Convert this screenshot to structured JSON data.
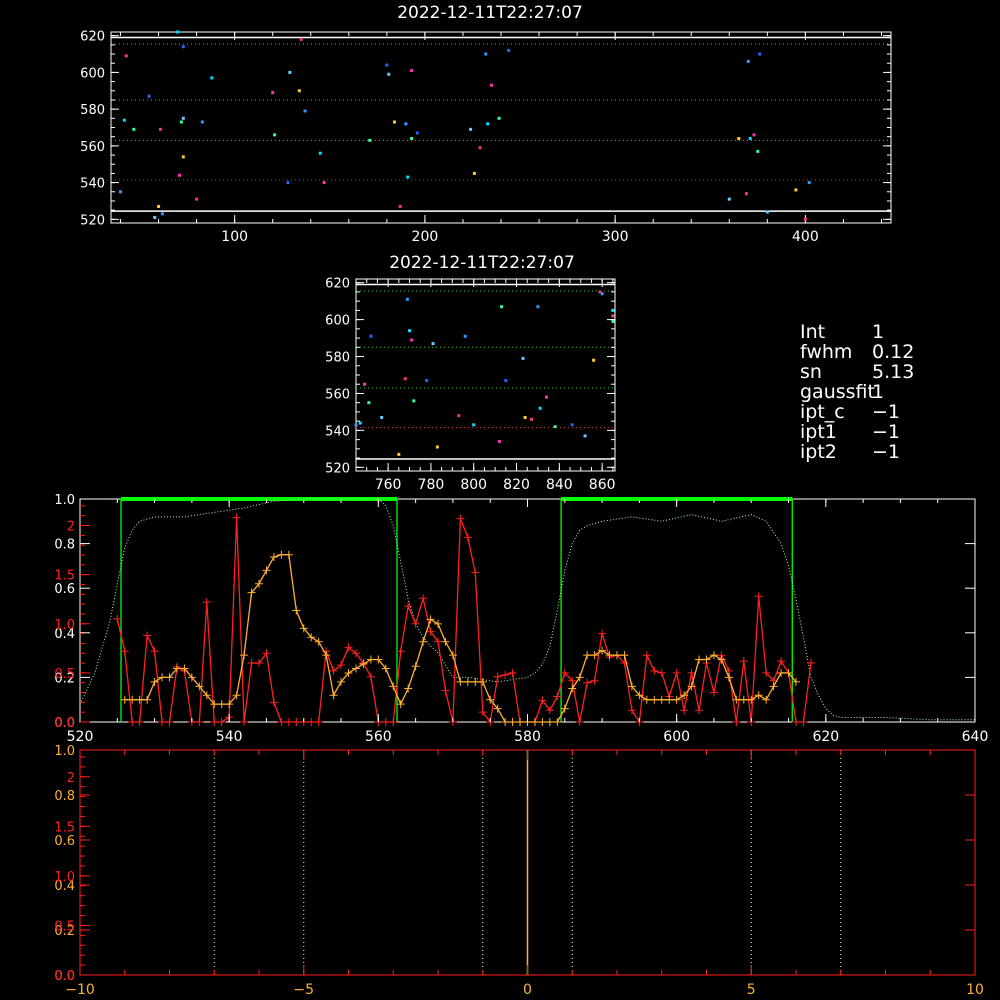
{
  "colors": {
    "bg": "#000000",
    "axis": "#ffffff",
    "red": "#ff2020",
    "orange": "#ffb030",
    "green": "#00ff00",
    "gdot": "#33cc33",
    "lgreen": "#b0ffb0"
  },
  "chart_data": [
    {
      "type": "scatter",
      "title": "2022-12-11T22:27:07",
      "xlim": [
        35,
        445
      ],
      "ylim": [
        518,
        622
      ],
      "xticks": [
        100,
        200,
        300,
        400
      ],
      "yticks": [
        520,
        540,
        560,
        580,
        600,
        620
      ],
      "white_lines_y": [
        524.5,
        619
      ],
      "dotted_lines_y": [
        541.5,
        563,
        585,
        615.5
      ],
      "points": [
        [
          40,
          535
        ],
        [
          42,
          574
        ],
        [
          43,
          609
        ],
        [
          47,
          569
        ],
        [
          55,
          587
        ],
        [
          58,
          521
        ],
        [
          60,
          527
        ],
        [
          61,
          569
        ],
        [
          62,
          523
        ],
        [
          70,
          622
        ],
        [
          71,
          544
        ],
        [
          72,
          573
        ],
        [
          73,
          614
        ],
        [
          73,
          575
        ],
        [
          73,
          554
        ],
        [
          80,
          531
        ],
        [
          83,
          573
        ],
        [
          88,
          597
        ],
        [
          120,
          589
        ],
        [
          121,
          566
        ],
        [
          128,
          540
        ],
        [
          129,
          600
        ],
        [
          134,
          590
        ],
        [
          135,
          618
        ],
        [
          137,
          579
        ],
        [
          145,
          556
        ],
        [
          147,
          540
        ],
        [
          171,
          563
        ],
        [
          180,
          604
        ],
        [
          181,
          599
        ],
        [
          184,
          573
        ],
        [
          187,
          527
        ],
        [
          190,
          572
        ],
        [
          191,
          543
        ],
        [
          193,
          601
        ],
        [
          193,
          564
        ],
        [
          196,
          567
        ],
        [
          224,
          569
        ],
        [
          226,
          545
        ],
        [
          229,
          559
        ],
        [
          232,
          610
        ],
        [
          233,
          572
        ],
        [
          235,
          593
        ],
        [
          239,
          575
        ],
        [
          244,
          612
        ],
        [
          360,
          531
        ],
        [
          365,
          564
        ],
        [
          369,
          534
        ],
        [
          370,
          606
        ],
        [
          371,
          564
        ],
        [
          373,
          566
        ],
        [
          375,
          557
        ],
        [
          376,
          610
        ],
        [
          380,
          524
        ],
        [
          395,
          536
        ],
        [
          400,
          520
        ],
        [
          402,
          540
        ]
      ]
    },
    {
      "type": "scatter",
      "title": "2022-12-11T22:27:07",
      "xlim": [
        745,
        866
      ],
      "ylim": [
        518,
        622
      ],
      "xticks": [
        760,
        780,
        800,
        820,
        840,
        860
      ],
      "yticks": [
        520,
        540,
        560,
        580,
        600,
        620
      ],
      "white_lines_y": [
        524.5,
        619
      ],
      "dotted_lines_y": [
        541.5,
        563,
        585,
        615.5
      ],
      "points": [
        [
          745,
          543
        ],
        [
          747,
          544
        ],
        [
          749,
          565
        ],
        [
          751,
          555
        ],
        [
          752,
          591
        ],
        [
          757,
          547
        ],
        [
          765,
          527
        ],
        [
          768,
          568
        ],
        [
          769,
          611
        ],
        [
          770,
          594
        ],
        [
          771,
          589
        ],
        [
          772,
          556
        ],
        [
          778,
          567
        ],
        [
          781,
          587
        ],
        [
          783,
          531
        ],
        [
          793,
          548
        ],
        [
          796,
          591
        ],
        [
          800,
          543
        ],
        [
          812,
          534
        ],
        [
          813,
          607
        ],
        [
          815,
          567
        ],
        [
          823,
          579
        ],
        [
          824,
          547
        ],
        [
          827,
          546
        ],
        [
          830,
          607
        ],
        [
          831,
          552
        ],
        [
          834,
          558
        ],
        [
          838,
          542
        ],
        [
          846,
          543
        ],
        [
          852,
          537
        ],
        [
          856,
          578
        ],
        [
          859,
          615
        ],
        [
          860,
          614
        ],
        [
          865,
          605
        ],
        [
          865,
          602
        ],
        [
          865,
          599
        ]
      ]
    },
    {
      "type": "line",
      "xlim": [
        520,
        640
      ],
      "xticks": [
        520,
        540,
        560,
        580,
        600,
        620,
        640
      ],
      "ylim_left": [
        0,
        1.0
      ],
      "yticks_left": [
        0.0,
        0.2,
        0.4,
        0.6,
        0.8,
        1.0
      ],
      "ylim_red": [
        0,
        2.27
      ],
      "yticks_red": [
        0.0,
        0.5,
        1.0,
        1.5,
        2.0
      ],
      "filter_x": [
        520,
        522,
        524,
        525,
        526,
        527,
        528,
        530,
        534,
        538,
        542,
        546,
        550,
        556,
        560,
        561,
        562,
        563,
        564,
        565,
        566,
        567,
        568,
        570,
        572,
        574,
        576,
        578,
        580,
        581,
        582,
        583,
        584,
        585,
        586,
        587,
        588,
        590,
        594,
        598,
        602,
        606,
        610,
        612,
        614,
        615,
        616,
        617,
        618,
        619,
        620,
        621,
        622,
        624,
        628,
        634,
        640
      ],
      "filter_y": [
        0.08,
        0.22,
        0.45,
        0.62,
        0.78,
        0.86,
        0.9,
        0.92,
        0.92,
        0.94,
        0.96,
        0.99,
        1.0,
        1.0,
        1.0,
        0.97,
        0.88,
        0.72,
        0.55,
        0.44,
        0.38,
        0.34,
        0.31,
        0.2,
        0.2,
        0.19,
        0.18,
        0.19,
        0.2,
        0.22,
        0.26,
        0.34,
        0.5,
        0.68,
        0.8,
        0.86,
        0.88,
        0.9,
        0.92,
        0.9,
        0.93,
        0.9,
        0.93,
        0.9,
        0.8,
        0.7,
        0.55,
        0.38,
        0.2,
        0.12,
        0.06,
        0.03,
        0.02,
        0.02,
        0.02,
        0.01,
        0.01
      ],
      "passbands": [
        [
          525.5,
          562.5
        ],
        [
          584.5,
          615.5
        ]
      ],
      "red": {
        "x": [
          525,
          526,
          527,
          528,
          529,
          530,
          531,
          532,
          533,
          534,
          535,
          536,
          537,
          538,
          539,
          540,
          541,
          542,
          543,
          544,
          545,
          546,
          547,
          548,
          549,
          550,
          551,
          552,
          553,
          554,
          555,
          556,
          557,
          558,
          559,
          560,
          561,
          562,
          563,
          564,
          565,
          566,
          567,
          568,
          569,
          570,
          571,
          572,
          573,
          574,
          575,
          576,
          577,
          578,
          579,
          580,
          581,
          582,
          583,
          584,
          585,
          586,
          587,
          588,
          589,
          590,
          591,
          592,
          593,
          594,
          595,
          596,
          597,
          598,
          599,
          600,
          601,
          602,
          603,
          604,
          605,
          606,
          607,
          608,
          609,
          610,
          611,
          612,
          613,
          614,
          615,
          616,
          617,
          618
        ],
        "y": [
          1.05,
          0.72,
          0.0,
          0.0,
          0.88,
          0.72,
          0.0,
          0.0,
          0.56,
          0.52,
          0.0,
          0.0,
          1.22,
          0.0,
          0.0,
          0.05,
          2.08,
          0.0,
          0.6,
          0.6,
          0.7,
          0.2,
          0.0,
          0.0,
          0.0,
          0.0,
          0.0,
          0.0,
          0.72,
          0.52,
          0.58,
          0.76,
          0.7,
          0.6,
          0.46,
          0.0,
          0.0,
          0.0,
          0.72,
          1.18,
          1.0,
          1.26,
          0.92,
          0.82,
          0.32,
          0.0,
          2.07,
          1.88,
          1.52,
          0.1,
          0.0,
          0.46,
          0.48,
          0.5,
          0.0,
          0.0,
          0.0,
          0.22,
          0.12,
          0.26,
          0.5,
          0.42,
          0.0,
          0.4,
          0.42,
          0.9,
          0.66,
          0.68,
          0.6,
          0.12,
          0.0,
          0.68,
          0.52,
          0.5,
          0.26,
          0.5,
          0.12,
          0.5,
          0.12,
          0.6,
          0.3,
          0.68,
          0.52,
          0.0,
          0.62,
          0.0,
          1.28,
          0.5,
          0.42,
          0.62,
          0.5,
          0.0,
          0.0,
          0.6
        ]
      },
      "orange": {
        "x": [
          526,
          527,
          528,
          529,
          530,
          531,
          532,
          533,
          534,
          535,
          536,
          537,
          538,
          539,
          540,
          541,
          542,
          543,
          544,
          545,
          546,
          547,
          548,
          549,
          550,
          551,
          552,
          553,
          554,
          555,
          556,
          557,
          558,
          559,
          560,
          561,
          562,
          563,
          564,
          565,
          566,
          567,
          568,
          569,
          570,
          571,
          572,
          573,
          574,
          575,
          576,
          577,
          578,
          579,
          580,
          581,
          582,
          583,
          584,
          585,
          586,
          587,
          588,
          589,
          590,
          591,
          592,
          593,
          594,
          595,
          596,
          597,
          598,
          599,
          600,
          601,
          602,
          603,
          604,
          605,
          606,
          607,
          608,
          609,
          610,
          611,
          612,
          613,
          614,
          615,
          616
        ],
        "y": [
          0.1,
          0.1,
          0.1,
          0.1,
          0.18,
          0.2,
          0.2,
          0.24,
          0.24,
          0.2,
          0.16,
          0.12,
          0.08,
          0.08,
          0.08,
          0.12,
          0.3,
          0.58,
          0.62,
          0.68,
          0.74,
          0.75,
          0.75,
          0.5,
          0.42,
          0.38,
          0.36,
          0.3,
          0.12,
          0.18,
          0.22,
          0.24,
          0.26,
          0.28,
          0.28,
          0.24,
          0.16,
          0.08,
          0.15,
          0.25,
          0.36,
          0.46,
          0.44,
          0.36,
          0.3,
          0.18,
          0.18,
          0.18,
          0.18,
          0.1,
          0.06,
          0.0,
          0.0,
          0.0,
          0.0,
          0.0,
          0.0,
          0.0,
          0.0,
          0.06,
          0.15,
          0.2,
          0.3,
          0.3,
          0.32,
          0.3,
          0.3,
          0.3,
          0.16,
          0.12,
          0.1,
          0.1,
          0.1,
          0.1,
          0.1,
          0.12,
          0.16,
          0.28,
          0.28,
          0.3,
          0.28,
          0.2,
          0.1,
          0.1,
          0.1,
          0.12,
          0.1,
          0.16,
          0.22,
          0.22,
          0.18
        ]
      }
    },
    {
      "type": "line",
      "xlim": [
        -10,
        10
      ],
      "xticks": [
        -10,
        -5,
        0,
        5,
        10
      ],
      "ylim_left": [
        0,
        1.0
      ],
      "yticks_left": [
        0.0,
        0.2,
        0.4,
        0.6,
        0.8,
        1.0
      ],
      "ylim_red": [
        0,
        2.27
      ],
      "yticks_red": [
        0.0,
        0.5,
        1.0,
        1.5,
        2.0
      ],
      "vlines_dotted": [
        -7,
        -5,
        -1,
        1,
        5,
        7
      ],
      "vline_orange": 0
    }
  ],
  "params": [
    {
      "key": "Int",
      "value": "1"
    },
    {
      "key": "fwhm",
      "value": "0.12"
    },
    {
      "key": "sn",
      "value": "5.13"
    },
    {
      "key": "gaussfit",
      "value": "1"
    },
    {
      "key": "ipt_c",
      "value": "−1"
    },
    {
      "key": "ipt1",
      "value": "−1"
    },
    {
      "key": "ipt2",
      "value": "−1"
    }
  ]
}
